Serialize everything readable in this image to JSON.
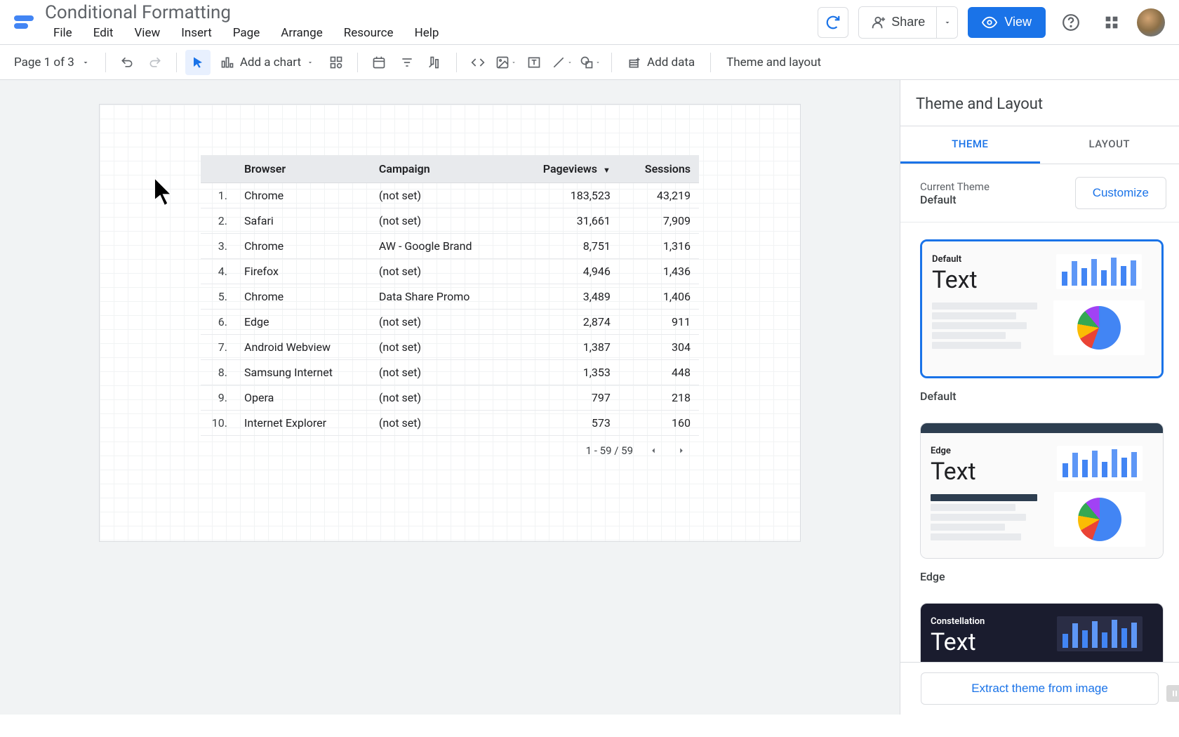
{
  "doc": {
    "title": "Conditional Formatting"
  },
  "menus": [
    "File",
    "Edit",
    "View",
    "Insert",
    "Page",
    "Arrange",
    "Resource",
    "Help"
  ],
  "header": {
    "share_label": "Share",
    "view_label": "View"
  },
  "toolbar": {
    "page_indicator": "Page 1 of 3",
    "add_chart_label": "Add a chart",
    "add_data_label": "Add data",
    "theme_layout_label": "Theme and layout"
  },
  "table": {
    "columns": [
      "",
      "Browser",
      "Campaign",
      "Pageviews",
      "Sessions"
    ],
    "sort_col": "Pageviews",
    "rows": [
      {
        "idx": "1.",
        "browser": "Chrome",
        "campaign": "(not set)",
        "pageviews": "183,523",
        "sessions": "43,219"
      },
      {
        "idx": "2.",
        "browser": "Safari",
        "campaign": "(not set)",
        "pageviews": "31,661",
        "sessions": "7,909"
      },
      {
        "idx": "3.",
        "browser": "Chrome",
        "campaign": "AW - Google Brand",
        "pageviews": "8,751",
        "sessions": "1,316"
      },
      {
        "idx": "4.",
        "browser": "Firefox",
        "campaign": "(not set)",
        "pageviews": "4,946",
        "sessions": "1,436"
      },
      {
        "idx": "5.",
        "browser": "Chrome",
        "campaign": "Data Share Promo",
        "pageviews": "3,489",
        "sessions": "1,406"
      },
      {
        "idx": "6.",
        "browser": "Edge",
        "campaign": "(not set)",
        "pageviews": "2,874",
        "sessions": "911"
      },
      {
        "idx": "7.",
        "browser": "Android Webview",
        "campaign": "(not set)",
        "pageviews": "1,387",
        "sessions": "304"
      },
      {
        "idx": "8.",
        "browser": "Samsung Internet",
        "campaign": "(not set)",
        "pageviews": "1,353",
        "sessions": "448"
      },
      {
        "idx": "9.",
        "browser": "Opera",
        "campaign": "(not set)",
        "pageviews": "797",
        "sessions": "218"
      },
      {
        "idx": "10.",
        "browser": "Internet Explorer",
        "campaign": "(not set)",
        "pageviews": "573",
        "sessions": "160"
      }
    ],
    "pagination": "1 - 59 / 59"
  },
  "panel": {
    "title": "Theme and Layout",
    "tabs": {
      "theme": "THEME",
      "layout": "LAYOUT"
    },
    "current_theme_label": "Current Theme",
    "current_theme_name": "Default",
    "customize_label": "Customize",
    "themes": [
      {
        "name": "Default",
        "preview_text": "Text"
      },
      {
        "name": "Edge",
        "preview_text": "Text"
      },
      {
        "name": "Constellation",
        "preview_text": "Text"
      }
    ],
    "extract_label": "Extract theme from image"
  }
}
